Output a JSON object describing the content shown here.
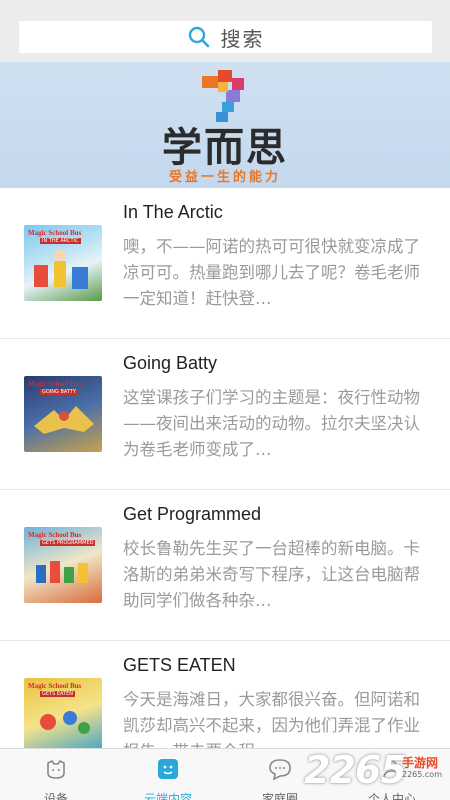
{
  "search": {
    "placeholder": "搜索",
    "icon": "search-icon"
  },
  "banner": {
    "brand": "学而思",
    "slogan": "受益一生的能力"
  },
  "lessons": [
    {
      "title": "In The Arctic",
      "description": "噢，不——阿诺的热可可很快就变凉成了凉可可。热量跑到哪儿去了呢？卷毛老师一定知道！赶快登…",
      "cover_label": "Magic School Bus",
      "cover_sub": "IN THE ARCTIC"
    },
    {
      "title": "Going Batty",
      "description": "这堂课孩子们学习的主题是：夜行性动物——夜间出来活动的动物。拉尔夫坚决认为卷毛老师变成了…",
      "cover_label": "Magic School Bus",
      "cover_sub": "GOING BATTY"
    },
    {
      "title": "Get Programmed",
      "description": "校长鲁勒先生买了一台超棒的新电脑。卡洛斯的弟弟米奇写下程序，让这台电脑帮助同学们做各种杂…",
      "cover_label": "Magic School Bus",
      "cover_sub": "GETS PROGRAMMED"
    },
    {
      "title": "GETS EATEN",
      "description": "今天是海滩日，大家都很兴奋。但阿诺和凯莎却高兴不起来，因为他们弄混了作业报告，带去要全程…",
      "cover_label": "Magic School Bus",
      "cover_sub": "GETS EATEN"
    }
  ],
  "tabs": [
    {
      "label": "设备",
      "icon": "cat-face-icon"
    },
    {
      "label": "云端内容",
      "icon": "cloud-content-icon",
      "active": true
    },
    {
      "label": "家庭圈",
      "icon": "chat-bubble-icon"
    },
    {
      "label": "个人中心",
      "icon": "person-icon"
    }
  ],
  "watermark": {
    "number": "2265",
    "text": "手游网",
    "url": "2265.com"
  },
  "colors": {
    "accent": "#2aa7dd",
    "banner_bg": "#c9dcf0",
    "slogan": "#e8772a"
  }
}
